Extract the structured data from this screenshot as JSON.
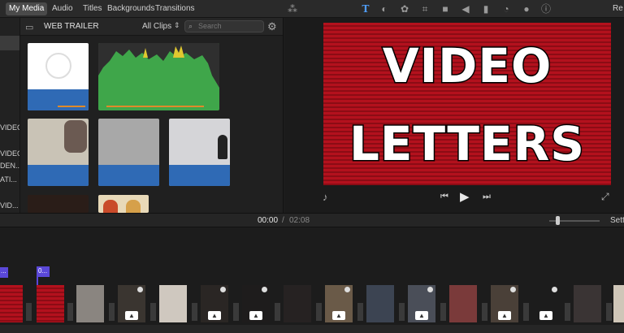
{
  "top_tabs": [
    "My Media",
    "Audio",
    "Titles",
    "Backgrounds",
    "Transitions"
  ],
  "top_right_label": "Re",
  "sidebar": {
    "items": [
      "VIDEO",
      "VIDEO",
      "DEN...",
      "ATI...",
      "VID..."
    ]
  },
  "browser": {
    "title": "WEB TRAILER",
    "filter_label": "All Clips",
    "search_placeholder": "Search"
  },
  "viewer": {
    "video_line1": "VIDEO",
    "video_line2": "LETTERS"
  },
  "timeline": {
    "current_time": "00:00",
    "separator": "/",
    "total_time": "02:08",
    "settings_label": "Sett",
    "marker1": "...",
    "marker2": "0..."
  },
  "icons": {
    "toolbar": [
      "magic-wand-icon",
      "title-text-icon",
      "color-balance-icon",
      "color-correction-icon",
      "crop-icon",
      "camera-stabilization-icon",
      "volume-icon",
      "equalizer-icon",
      "speed-icon",
      "noise-reduction-icon",
      "info-icon"
    ]
  },
  "colors": {
    "accent_blue": "#4f9cf7",
    "video_red": "#b3111d",
    "audio_blue": "#2f6ab5",
    "waveform_green": "#3fa64a",
    "marker_purple": "#5a48d8"
  }
}
